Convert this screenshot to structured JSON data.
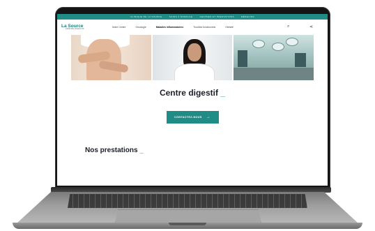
{
  "topbar": {
    "links": [
      "CLINIQUE DE LA SOURCE",
      "SOINS À DOMICILE",
      "CENTRES ET PRESTATIONS",
      "MÉDECINS"
    ]
  },
  "header": {
    "logo_name": "La Source",
    "logo_sub": "CENTRE DIGESTIF",
    "nav": [
      "Notre Centre",
      "Oncologie",
      "Maladies inflammatoires",
      "Troubles fonctionnels",
      "Obésité"
    ],
    "active_nav": "Maladies inflammatoires",
    "icons": [
      "search-icon",
      "share-icon"
    ]
  },
  "main": {
    "title": "Centre digestif",
    "title_mark": "_",
    "cta_label": "CONTACTEZ-NOUS",
    "cta_arrow": "→",
    "section_title": "Nos prestations",
    "section_mark": "_"
  },
  "colors": {
    "brand": "#1f8c86",
    "accent": "#1f9d8f",
    "text_dark": "#1b1f2a"
  }
}
